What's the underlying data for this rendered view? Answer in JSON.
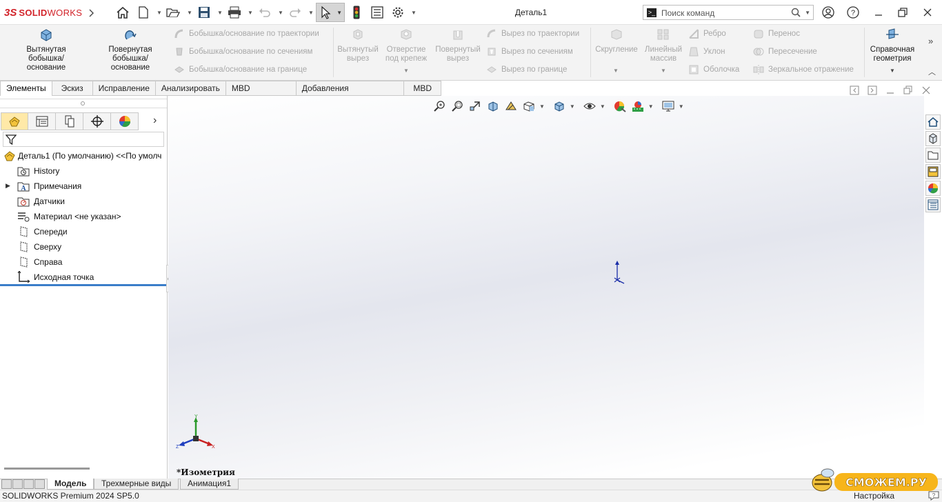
{
  "app": {
    "logo_prefix": "3S",
    "logo_text_a": "SOLID",
    "logo_text_b": "WORKS",
    "document_title": "Деталь1"
  },
  "search": {
    "placeholder": "Поиск команд"
  },
  "command_manager": {
    "extruded_boss": "Вытянутая бобышка/основание",
    "revolved_boss": "Повернутая бобышка/основание",
    "swept_boss": "Бобышка/основание по траектории",
    "lofted_boss": "Бобышка/основание по сечениям",
    "boundary_boss": "Бобышка/основание на границе",
    "extruded_cut": "Вытянутый вырез",
    "hole_wizard": "Отверстие под крепеж",
    "revolved_cut": "Повернутый вырез",
    "swept_cut": "Вырез по траектории",
    "lofted_cut": "Вырез по сечениям",
    "boundary_cut": "Вырез по границе",
    "fillet": "Скругление",
    "linear_pattern": "Линейный массив",
    "rib": "Ребро",
    "draft": "Уклон",
    "shell": "Оболочка",
    "wrap": "Перенос",
    "intersect": "Пересечение",
    "mirror": "Зеркальное отражение",
    "reference_geometry": "Справочная геометрия"
  },
  "tabs": [
    "Элементы",
    "Эскиз",
    "Исправление",
    "Анализировать",
    "MBD Dimensions",
    "Добавления SOLIDWORKS",
    "MBD"
  ],
  "feature_tree": {
    "root": "Деталь1 (По умолчанию) <<По умолч",
    "items": [
      "History",
      "Примечания",
      "Датчики",
      "Материал <не указан>",
      "Спереди",
      "Сверху",
      "Справа",
      "Исходная точка"
    ]
  },
  "viewport": {
    "view_name": "*Изометрия",
    "triad_x": "X",
    "triad_y": "Y",
    "triad_z": "Z"
  },
  "bottom_tabs": [
    "Модель",
    "Трехмерные виды",
    "Анимация1"
  ],
  "status": {
    "product": "SOLIDWORKS Premium 2024 SP5.0",
    "customize": "Настройка"
  },
  "watermark": "СМОЖЕМ.РУ",
  "colors": {
    "brand_red": "#d2232a",
    "rollback_blue": "#3a7dc9",
    "active_tab_fm": "#ffe9a8"
  }
}
